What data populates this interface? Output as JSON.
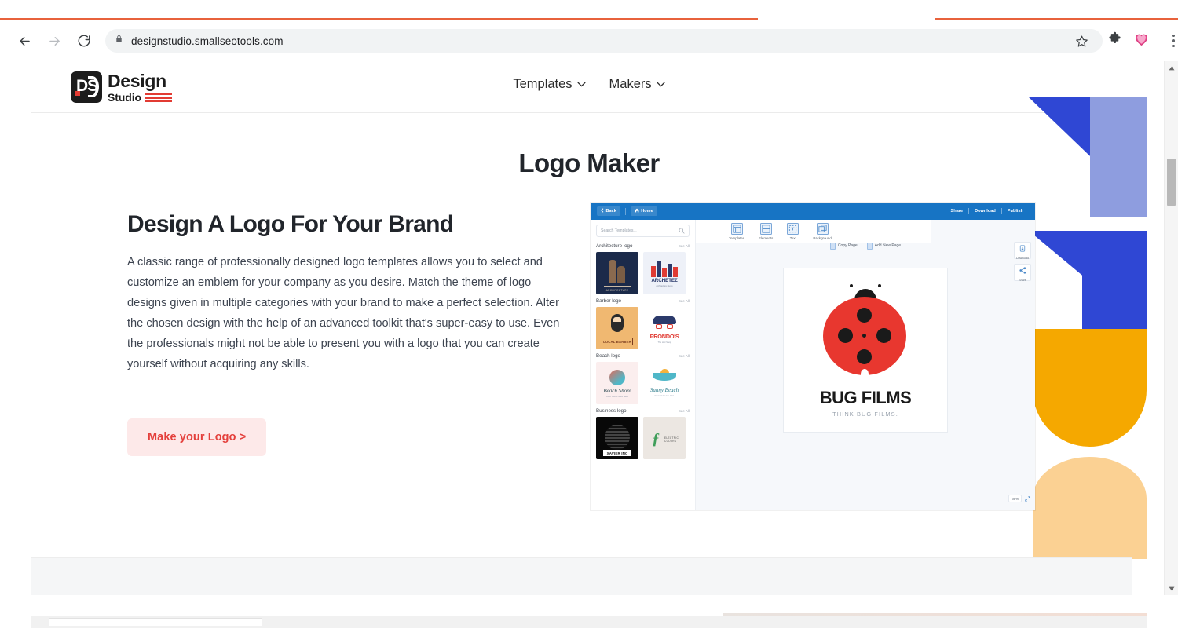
{
  "browser": {
    "url": "designstudio.smallseotools.com",
    "lock_icon": "lock-icon",
    "back_icon": "back-arrow-icon",
    "forward_icon": "forward-arrow-icon",
    "reload_icon": "reload-icon",
    "bookmark_icon": "star-icon",
    "extensions_icon": "puzzle-piece-icon",
    "heart_icon": "heart-icon",
    "menu_icon": "three-dot-menu-icon"
  },
  "site": {
    "logo": {
      "mark_text": "DS",
      "name_line1": "Design",
      "name_line2": "Studio"
    },
    "nav": [
      {
        "label": "Templates",
        "caret": "⌄"
      },
      {
        "label": "Makers",
        "caret": "⌄"
      }
    ],
    "page_title": "Logo Maker"
  },
  "hero": {
    "heading": "Design A Logo For Your Brand",
    "paragraph": "A classic range of professionally designed logo templates allows you to select and customize an emblem for your company as you desire. Match the theme of logo designs given in multiple categories with your brand to make a perfect selection. Alter the chosen design with the help of an advanced toolkit that's super-easy to use. Even the professionals might not be able to present you with a logo that you can create yourself without acquiring any skills.",
    "cta_label": "Make your Logo >"
  },
  "colors": {
    "cta_text": "#e4403c",
    "cta_bg": "#fde9e9",
    "brand_red": "#e23b33",
    "app_blue": "#1774c4",
    "shape_blue": "#2f47d4",
    "shape_blue_light": "#8e9ddf",
    "shape_orange": "#f5a800",
    "shape_peach": "#fbd193",
    "logo_red": "#e8372f"
  },
  "mockup": {
    "topbar": {
      "back_label": "Back",
      "back_icon": "chevron-left-icon",
      "home_label": "Home",
      "home_icon": "home-icon",
      "actions": [
        "Share",
        "Download",
        "Publish"
      ]
    },
    "tools": [
      {
        "label": "Templates",
        "icon": "templates-grid-icon"
      },
      {
        "label": "Elements",
        "icon": "elements-grid-icon"
      },
      {
        "label": "Text",
        "icon": "text-box-icon"
      },
      {
        "label": "Background",
        "icon": "background-layers-icon"
      }
    ],
    "sidebar": {
      "search_placeholder": "Search Templates...",
      "search_icon": "search-icon",
      "see_all_label": "See All",
      "categories": [
        {
          "label": "Architecture logo",
          "items": [
            {
              "name": "ARCHITECTURE",
              "style": "t-arch"
            },
            {
              "name": "ARCHETEZ",
              "tagline": "architecture studio",
              "style": "t-archetez"
            }
          ]
        },
        {
          "label": "Barber logo",
          "items": [
            {
              "name": "LOCAL BARBER",
              "style": "t-barber"
            },
            {
              "name": "PRONDO'S",
              "tagline": "The Hair Shop",
              "style": "t-prondos"
            }
          ]
        },
        {
          "label": "Beach logo",
          "items": [
            {
              "name": "Beach Shore",
              "tagline": "SUN SAND AND SEA",
              "style": "t-beachshore"
            },
            {
              "name": "Sunny Beach",
              "tagline": "RESORT AND SPA",
              "style": "t-sunny"
            }
          ]
        },
        {
          "label": "Business logo",
          "items": [
            {
              "name": "XAVIER INC",
              "style": "t-xavier"
            },
            {
              "name": "ELECTRIC COLORS",
              "style": "t-electric"
            }
          ]
        }
      ]
    },
    "canvas": {
      "copy_page_label": "Copy Page",
      "add_page_label": "Add New Page",
      "download_label": "Download",
      "share_label": "Share",
      "download_icon": "download-icon",
      "share_icon": "share-nodes-icon",
      "zoom_level": "66%",
      "expand_icon": "expand-arrows-icon",
      "logo": {
        "title": "BUG FILMS",
        "tagline": "THINK BUG FILMS.",
        "art": "ladybug-film-reel"
      }
    }
  },
  "scrollbars": {
    "vertical_up_icon": "scroll-up-arrow-icon",
    "vertical_down_icon": "scroll-down-arrow-icon"
  }
}
